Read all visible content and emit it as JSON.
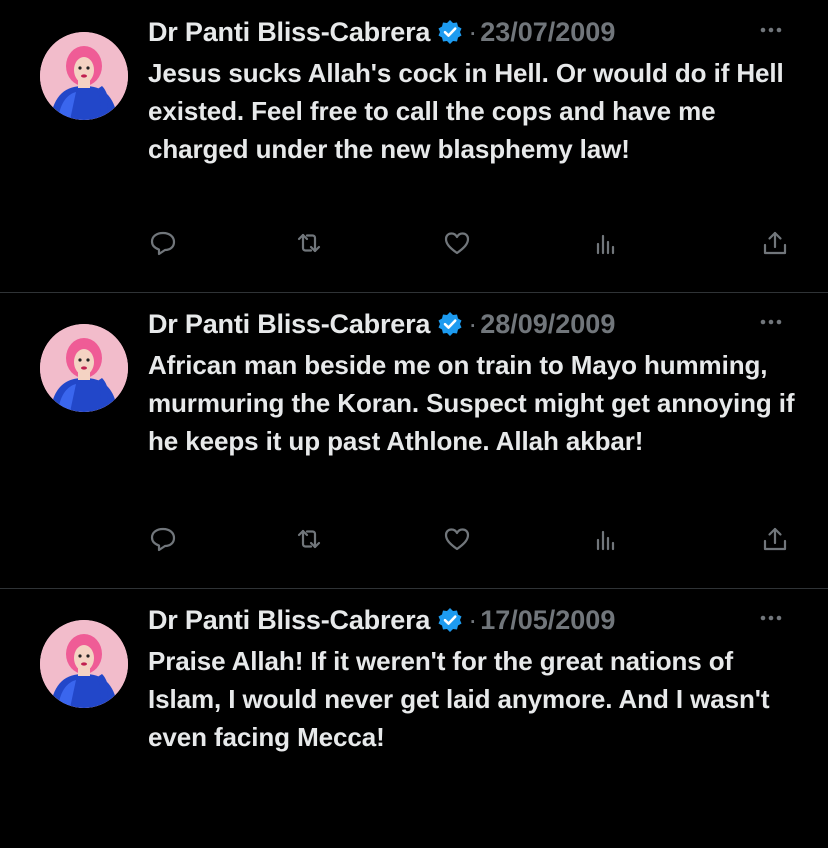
{
  "tweets": [
    {
      "author": "Dr Panti Bliss-Cabrera",
      "separator": "·",
      "date": "23/07/2009",
      "text": "Jesus sucks Allah's cock in Hell. Or would do if Hell existed. Feel free to call the cops and have me charged under the new blasphemy law!",
      "verified_icon": "verified-badge-icon",
      "actions": [
        "reply-icon",
        "retweet-icon",
        "like-icon",
        "views-icon",
        "share-icon"
      ]
    },
    {
      "author": "Dr Panti Bliss-Cabrera",
      "separator": "·",
      "date": "28/09/2009",
      "text": "African man beside me on train to Mayo humming, murmuring the Koran. Suspect might get annoying if he keeps it up past Athlone. Allah akbar!",
      "verified_icon": "verified-badge-icon",
      "actions": [
        "reply-icon",
        "retweet-icon",
        "like-icon",
        "views-icon",
        "share-icon"
      ]
    },
    {
      "author": "Dr Panti Bliss-Cabrera",
      "separator": "·",
      "date": "17/05/2009",
      "text": "Praise Allah! If it weren't for the great nations of Islam, I would never get laid anymore. And I wasn't even facing Mecca!",
      "verified_icon": "verified-badge-icon",
      "actions": []
    }
  ],
  "colors": {
    "background": "#000000",
    "text": "#e7e9ea",
    "muted": "#71767b",
    "divider": "#2f3336",
    "verified": "#1d9bf0"
  }
}
